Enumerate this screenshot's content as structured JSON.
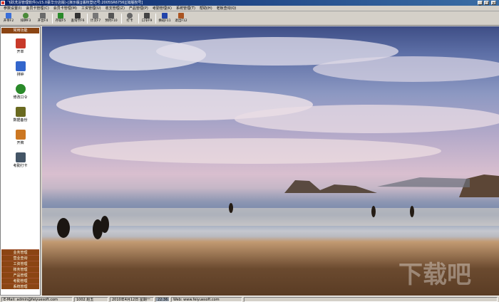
{
  "titlebar": {
    "title": "飞跃洗浴管理软件(v15.0豪华分店版)-[演示版][版权登记号:2005SR6756][如版权号]"
  },
  "menu": [
    "参数设置(I)",
    "会员卡管理(C)",
    "会员卡管理(M)",
    "工资管理(U)",
    "收支管理(Z)",
    "产品管理(P)",
    "考勤管理(K)",
    "系统管理(T)",
    "帮助(H)",
    "老板查询(Q)"
  ],
  "toolbar": [
    {
      "label": "开单F2",
      "icon": "open-order-icon",
      "color": "#3a6fd8"
    },
    {
      "label": "排钟F3",
      "icon": "clock-icon",
      "color": "#4a8a3a"
    },
    {
      "label": "开台F4",
      "icon": "table-icon",
      "color": "#6a6a6a"
    },
    {
      "label": "存取F5",
      "icon": "deposit-icon",
      "color": "#2a8a2a"
    },
    {
      "label": "查询卡F6",
      "icon": "binoculars-icon",
      "color": "#333"
    },
    {
      "label": "计次F7",
      "icon": "count-icon",
      "color": "#777"
    },
    {
      "label": "预约F10",
      "icon": "reserve-icon",
      "color": "#555"
    },
    {
      "label": "打卡",
      "icon": "punch-icon",
      "color": "#666"
    },
    {
      "label": "口令F9",
      "icon": "key-icon",
      "color": "#444"
    },
    {
      "label": "换班F11",
      "icon": "shift-icon",
      "color": "#2244aa"
    },
    {
      "label": "退出F12",
      "icon": "exit-icon",
      "color": "#aa5522"
    }
  ],
  "sidebar": {
    "header": "常用功能",
    "items": [
      {
        "label": "开单",
        "icon": "open-order-icon",
        "color": "#c83a2a"
      },
      {
        "label": "排钟",
        "icon": "clock-icon",
        "color": "#3366cc"
      },
      {
        "label": "修改口令",
        "icon": "password-icon",
        "color": "#2a8a2a"
      },
      {
        "label": "数据备份",
        "icon": "backup-icon",
        "color": "#6a6a20"
      },
      {
        "label": "开牌",
        "icon": "card-icon",
        "color": "#cc7722"
      },
      {
        "label": "考勤打卡",
        "icon": "attendance-icon",
        "color": "#445566"
      }
    ],
    "bottom": [
      "业务管理",
      "营业查询",
      "工资管理",
      "账务管理",
      "产品管理",
      "考勤管理",
      "系统管理"
    ]
  },
  "status": {
    "email": "E-Mail: admin@feiyuesoft.com",
    "operator": "1002  赵五",
    "date": "2010年4月12日  星期一",
    "time": "22:36:06",
    "web": "Web: www.feiyuesoft.com"
  }
}
